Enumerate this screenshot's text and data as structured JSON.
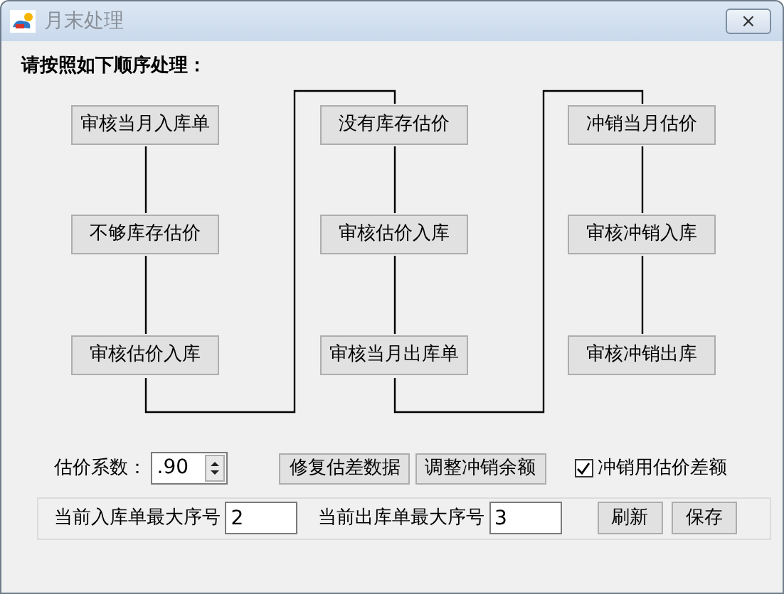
{
  "window": {
    "title": "月末处理",
    "close": "⨯"
  },
  "instruction": "请按照如下顺序处理：",
  "steps": [
    [
      "审核当月入库单",
      "不够库存估价",
      "审核估价入库"
    ],
    [
      "没有库存估价",
      "审核估价入库",
      "审核当月出库单"
    ],
    [
      "冲销当月估价",
      "审核冲销入库",
      "审核冲销出库"
    ]
  ],
  "coefficient": {
    "label": "估价系数：",
    "value": ".90"
  },
  "actions": [
    "修复估差数据",
    "调整冲销余额"
  ],
  "option": {
    "label": "冲销用估价差额",
    "checked": true
  },
  "sequence": {
    "fields": [
      {
        "label": "当前入库单最大序号",
        "value": "2"
      },
      {
        "label": "当前出库单最大序号",
        "value": "3"
      }
    ],
    "buttons": [
      "刷新",
      "保存"
    ]
  }
}
